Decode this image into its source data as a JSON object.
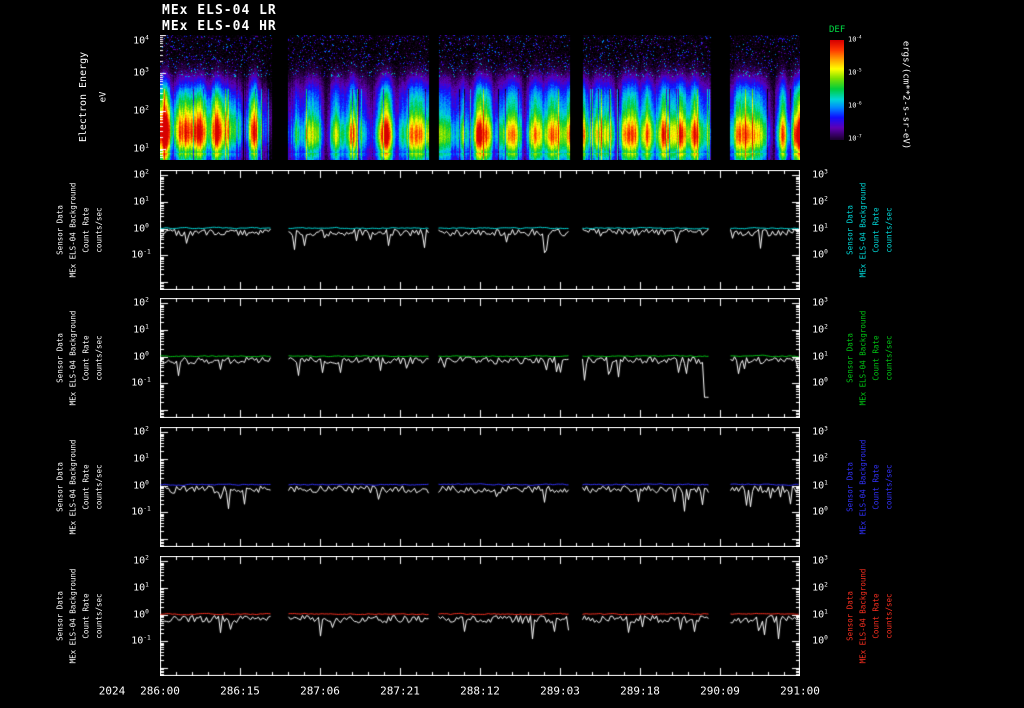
{
  "titles": {
    "lr": "MEx ELS-04 LR",
    "hr": "MEx ELS-04 HR"
  },
  "axis": {
    "year": "2024"
  },
  "spectrogram": {
    "ylabel": "Electron Energy",
    "ylabel_units": "eV",
    "y_tick_labels": [
      "10^4",
      "10^3",
      "10^2",
      "10^1"
    ],
    "colorbar": {
      "label": "DEF",
      "label_color": "#00dd44",
      "tick_labels": [
        "10^-4",
        "10^-5",
        "10^-6",
        "10^-7"
      ],
      "units": "ergs/(cm**2-s-sr-eV)"
    }
  },
  "panel_labels": {
    "left_rotated": [
      "Sensor Data",
      "MEx ELS-04 Background",
      "Count Rate",
      "counts/sec"
    ],
    "right_rotated": [
      "Sensor Data",
      "MEx ELS-04 Background",
      "Count Rate",
      "counts/sec"
    ],
    "left_y_ticks": [
      "10^2",
      "10^1",
      "10^0",
      "10^-1"
    ],
    "right_y_ticks": [
      "10^3",
      "10^2",
      "10^1",
      "10^0"
    ]
  },
  "chart_data": {
    "x_axis": {
      "year": "2024",
      "tick_labels": [
        "286:00",
        "286:15",
        "287:06",
        "287:21",
        "288:12",
        "289:03",
        "289:18",
        "290:09",
        "291:00"
      ],
      "tick_interval": "15 hours (day-of-year:hour)",
      "data_segments_frac": [
        [
          0.0,
          0.175
        ],
        [
          0.2,
          0.42
        ],
        [
          0.435,
          0.64
        ],
        [
          0.66,
          0.86
        ],
        [
          0.89,
          1.0
        ]
      ],
      "data_gaps_frac": [
        [
          0.175,
          0.2
        ],
        [
          0.42,
          0.435
        ],
        [
          0.64,
          0.66
        ],
        [
          0.86,
          0.89
        ]
      ]
    },
    "charts": [
      {
        "type": "heatmap",
        "title": "MEx ELS-04 LR/HR electron energy-time spectrogram",
        "ylabel": "Electron Energy (eV)",
        "y_scale": "log",
        "ylim": [
          5,
          10000
        ],
        "y_ticks": [
          10,
          100,
          1000,
          10000
        ],
        "z_label": "DEF",
        "z_units": "ergs/(cm**2-s-sr-eV)",
        "z_scale": "log",
        "z_ticks": [
          1e-07,
          1e-06,
          1e-05,
          0.0001
        ],
        "colormap": "rainbow (purple/blue = low flux, yellow/red = high flux)",
        "spectral_shape": {
          "peak_energy_eV": 22,
          "peak_gauss_sigma_decades": 0.45,
          "secondary_energy_eV": 220,
          "secondary_relative_amplitude": 0.4,
          "flux_above_1keV": "near background: black with sparse purple speckle"
        },
        "segment_relative_intensity": [
          1.25,
          0.95,
          1.0,
          1.0,
          0.92
        ],
        "notes": "Five data segments separated by black gaps; day-286 segment shows the most intense red cores near 20-100 eV, later segments green-yellow."
      },
      {
        "type": "line",
        "panel": "background-count-rate-1",
        "y_scale": "log",
        "ylim": [
          0.01,
          100
        ],
        "y_ticks": [
          0.1,
          1,
          10,
          100
        ],
        "right_y_ticks": [
          1,
          10,
          100,
          1000
        ],
        "series": [
          {
            "name": "MEx ELS-04 background count rate",
            "color": "#00dcdc",
            "typical_value": 1.05,
            "log10_scatter": 0.05
          },
          {
            "name": "MEx ELS-04 count rate",
            "color": "#ffffff",
            "typical_value": 0.72,
            "log10_scatter": 0.14,
            "occasional_dips_to": 0.2
          }
        ]
      },
      {
        "type": "line",
        "panel": "background-count-rate-2",
        "y_scale": "log",
        "ylim": [
          0.01,
          100
        ],
        "y_ticks": [
          0.1,
          1,
          10,
          100
        ],
        "right_y_ticks": [
          1,
          10,
          100,
          1000
        ],
        "dip_event": {
          "frac": 0.853,
          "min_value": 0.03
        },
        "series": [
          {
            "name": "MEx ELS-04 background count rate",
            "color": "#00c814",
            "typical_value": 1.05,
            "log10_scatter": 0.05
          },
          {
            "name": "MEx ELS-04 count rate",
            "color": "#ffffff",
            "typical_value": 0.72,
            "log10_scatter": 0.14,
            "occasional_dips_to": 0.2
          }
        ]
      },
      {
        "type": "line",
        "panel": "background-count-rate-3",
        "y_scale": "log",
        "ylim": [
          0.01,
          100
        ],
        "y_ticks": [
          0.1,
          1,
          10,
          100
        ],
        "right_y_ticks": [
          1,
          10,
          100,
          1000
        ],
        "series": [
          {
            "name": "MEx ELS-04 background count rate",
            "color": "#3232ff",
            "typical_value": 1.1,
            "log10_scatter": 0.05
          },
          {
            "name": "MEx ELS-04 count rate",
            "color": "#ffffff",
            "typical_value": 0.72,
            "log10_scatter": 0.14,
            "occasional_dips_to": 0.2
          }
        ]
      },
      {
        "type": "line",
        "panel": "background-count-rate-4",
        "y_scale": "log",
        "ylim": [
          0.01,
          100
        ],
        "y_ticks": [
          0.1,
          1,
          10,
          100
        ],
        "right_y_ticks": [
          1,
          10,
          100,
          1000
        ],
        "series": [
          {
            "name": "MEx ELS-04 background count rate",
            "color": "#ff3020",
            "typical_value": 1.05,
            "log10_scatter": 0.05
          },
          {
            "name": "MEx ELS-04 count rate",
            "color": "#ffffff",
            "typical_value": 0.68,
            "log10_scatter": 0.14,
            "occasional_dips_to": 0.2
          }
        ]
      }
    ]
  }
}
